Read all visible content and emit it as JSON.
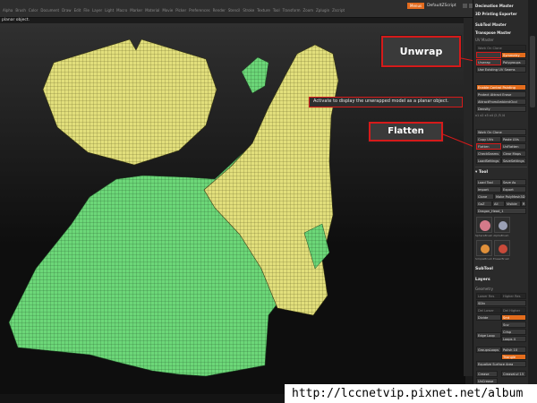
{
  "menubar": {
    "items": [
      "Alpha",
      "Brush",
      "Color",
      "Document",
      "Draw",
      "Edit",
      "File",
      "Layer",
      "Light",
      "Macro",
      "Marker",
      "Material",
      "Movie",
      "Picker",
      "Preferences",
      "Render",
      "Stencil",
      "Stroke",
      "Texture",
      "Tool",
      "Transform",
      "Zoom",
      "Zplugin",
      "Zscript"
    ],
    "menus_button": "Menus",
    "script_label": "DefaultZScript"
  },
  "note": "planar object.",
  "callouts": {
    "unwrap": "Unwrap",
    "flatten": "Flatten",
    "tooltip": "Activate to display the unwrapped model as a planar object."
  },
  "panel": {
    "top_items": [
      "Decimation Master",
      "3D Printing Exporter",
      "SubTool Master",
      "Transpose Master",
      "UV Master"
    ],
    "uv": {
      "work_on_clone": "Work On Clone",
      "symmetry": "Symmetry",
      "unwrap": "Unwrap",
      "polygroups": "Polygroups",
      "use_existing": "Use Existing UV Seams",
      "enable_control_painting": "Enable Control Painting",
      "protect_attract": "Protect Attract Erase",
      "attract_from_ao": "AttractFromAmbientOccl",
      "density": "Density",
      "density_values": [
        "x1",
        "x2",
        "x3",
        "x4",
        "/2",
        "/3",
        "/4"
      ],
      "work_on_clone_2": "Work On Clone",
      "copy_uvs": "Copy UVs",
      "paste_uvs": "Paste UVs",
      "flatten": "Flatten",
      "unflatten": "UnFlatten",
      "checkseams": "CheckSeams",
      "clear_maps": "Clear Maps",
      "load_settings": "LoadSettings",
      "save_settings": "SaveSettings"
    },
    "tool": {
      "title": "Tool",
      "load_tool": "Load Tool",
      "save_as": "Save As",
      "import": "Import",
      "export": "Export",
      "clone": "Clone",
      "make_polymesh": "Make PolyMesh3D",
      "goz": "GoZ",
      "all": "All",
      "visible": "Visible",
      "r": "R",
      "lightbox_tools": "Lightbox>Tools",
      "current_tool": "Dragon_Head_1",
      "thumbs": [
        "SphereBrush",
        "AlphaBrush",
        "SimpleBrush",
        "EraserBrush"
      ]
    },
    "subtool": "SubTool",
    "layers": "Layers",
    "geometry": {
      "title": "Geometry",
      "lower_res": "Lower Res",
      "higher_res": "Higher Res",
      "sdiv": "SDiv",
      "cage": "Cage",
      "rstr": "Rstr",
      "del_lower": "Del Lower",
      "del_higher": "Del Higher",
      "freeze": "Freeze SubDivision Levels",
      "reconstruct": "Reconstruct Subdiv",
      "divide": "Divide",
      "smt": "Smt",
      "suv": "Suv",
      "rsmt": "ReSmt",
      "edge_loop": "Edge Loop",
      "crisp": "Crisp",
      "groupsloops": "GroupsLoops",
      "loops": "Loops 4",
      "polish": "Polish 10",
      "triangle": "Triangle",
      "equalize": "Equalize Surface Area",
      "crease": "Crease",
      "crease_level": "CreaseLvl 15",
      "uncrease": "UnCrease"
    }
  },
  "watermark": "http://lccnetvip.pixnet.net/album",
  "colors": {
    "yellow": "#e2df7c",
    "green": "#6cd778",
    "accent_orange": "#e36c1c",
    "callout_red": "#d51a1a"
  }
}
